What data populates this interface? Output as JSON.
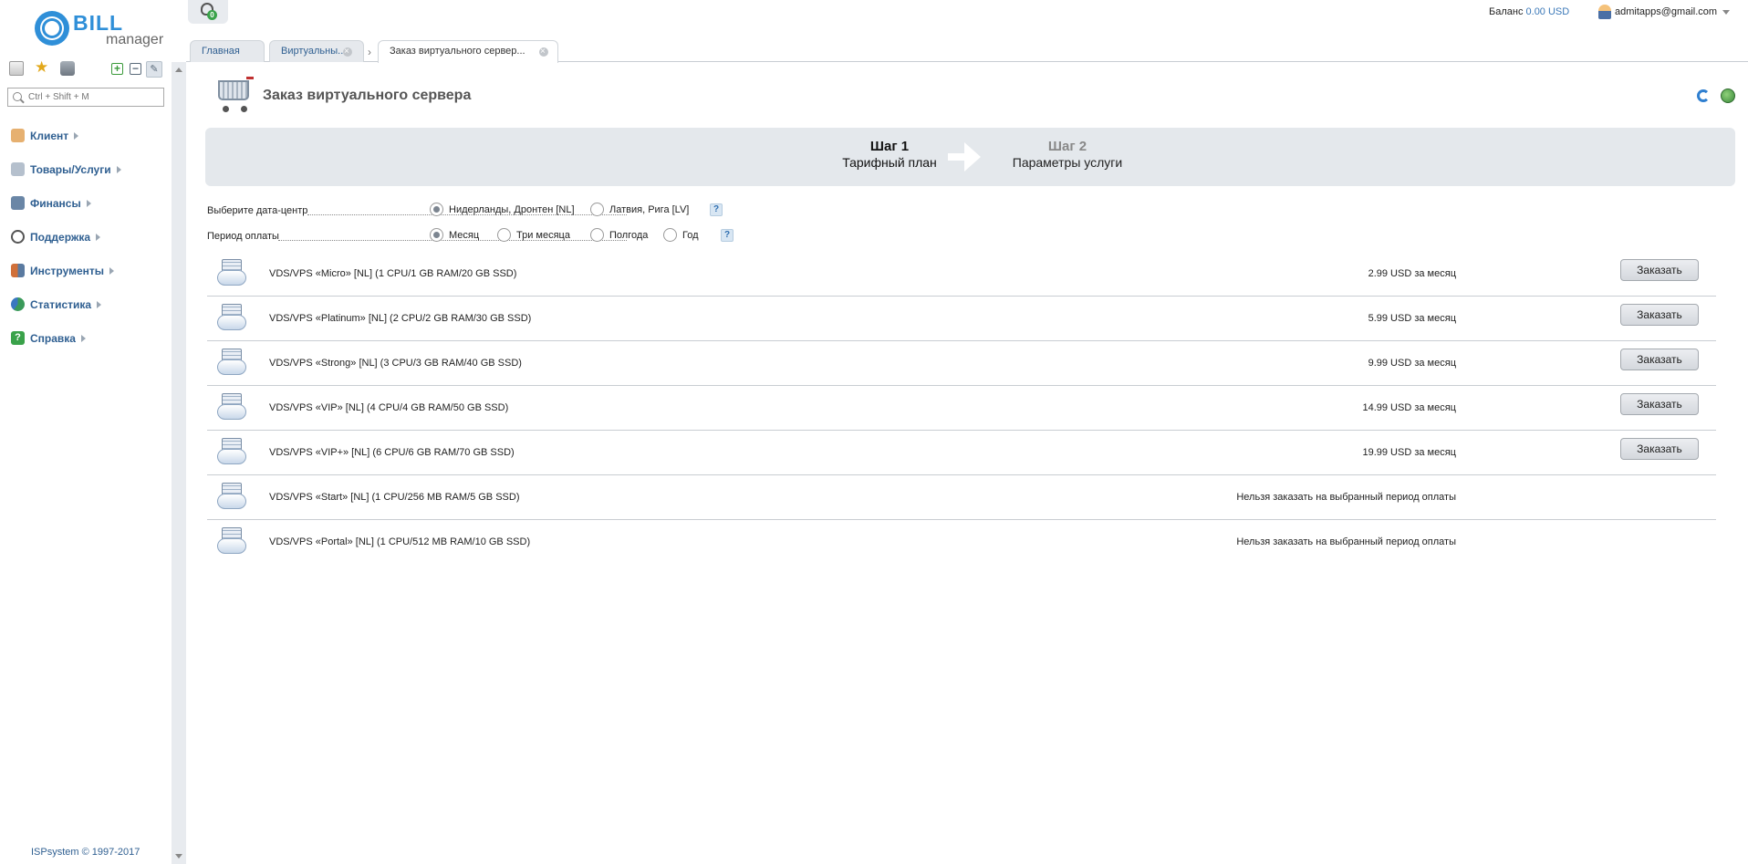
{
  "brand": {
    "bill": "BILL",
    "manager": "manager"
  },
  "sidebar": {
    "search_placeholder": "Ctrl + Shift + M",
    "tools": [
      "tree-view-icon",
      "favorites-star-icon",
      "briefcase-icon",
      "expand-all-icon",
      "collapse-all-icon",
      "pin-icon"
    ],
    "items": [
      {
        "label": "Клиент",
        "icon": "client-icon",
        "color": "#d08a3a"
      },
      {
        "label": "Товары/Услуги",
        "icon": "cart-icon",
        "color": "#6b7f99"
      },
      {
        "label": "Финансы",
        "icon": "finance-icon",
        "color": "#4a6a8a"
      },
      {
        "label": "Поддержка",
        "icon": "headset-icon",
        "color": "#555555"
      },
      {
        "label": "Инструменты",
        "icon": "tools-icon",
        "color": "#c0603a"
      },
      {
        "label": "Статистика",
        "icon": "stats-icon",
        "color": "#3a9a5a"
      },
      {
        "label": "Справка",
        "icon": "help-icon",
        "color": "#3aa24a"
      }
    ],
    "copyright": "ISPsystem © 1997-2017"
  },
  "topbar": {
    "notification_count": "0",
    "balance_label": "Баланс",
    "balance_value": "0.00 USD",
    "user": "admitapps@gmail.com"
  },
  "tabs": [
    {
      "label": "Главная"
    },
    {
      "label": "Виртуальны..."
    },
    {
      "label": "Заказ виртуального сервер..."
    }
  ],
  "page": {
    "title": "Заказ виртуального сервера"
  },
  "steps": [
    {
      "num": "Шаг 1",
      "name": "Тарифный план"
    },
    {
      "num": "Шаг 2",
      "name": "Параметры услуги"
    }
  ],
  "form": {
    "datacenter": {
      "label": "Выберите дата-центр",
      "options": [
        "Нидерланды, Дронтен [NL]",
        "Латвия, Рига [LV]"
      ],
      "selected": 0
    },
    "period": {
      "label": "Период оплаты",
      "options": [
        "Месяц",
        "Три месяца",
        "Полгода",
        "Год"
      ],
      "selected": 0
    },
    "help_label": "?"
  },
  "order_button": "Заказать",
  "tariffs": [
    {
      "name": "VDS/VPS «Micro» [NL] (1 CPU/1 GB RAM/20 GB SSD)",
      "price": "2.99 USD за месяц",
      "orderable": true
    },
    {
      "name": "VDS/VPS «Platinum» [NL] (2 CPU/2 GB RAM/30 GB SSD)",
      "price": "5.99 USD за месяц",
      "orderable": true
    },
    {
      "name": "VDS/VPS «Strong» [NL] (3 CPU/3 GB RAM/40 GB SSD)",
      "price": "9.99 USD за месяц",
      "orderable": true
    },
    {
      "name": "VDS/VPS «VIP» [NL] (4 CPU/4 GB RAM/50 GB SSD)",
      "price": "14.99 USD за месяц",
      "orderable": true
    },
    {
      "name": "VDS/VPS «VIP+» [NL] (6 CPU/6 GB RAM/70 GB SSD)",
      "price": "19.99 USD за месяц",
      "orderable": true
    },
    {
      "name": "VDS/VPS «Start» [NL] (1 CPU/256 MB RAM/5 GB SSD)",
      "price": "Нельзя заказать на выбранный период оплаты",
      "orderable": false
    },
    {
      "name": "VDS/VPS «Portal» [NL] (1 CPU/512 MB RAM/10 GB SSD)",
      "price": "Нельзя заказать на выбранный период оплаты",
      "orderable": false
    }
  ]
}
